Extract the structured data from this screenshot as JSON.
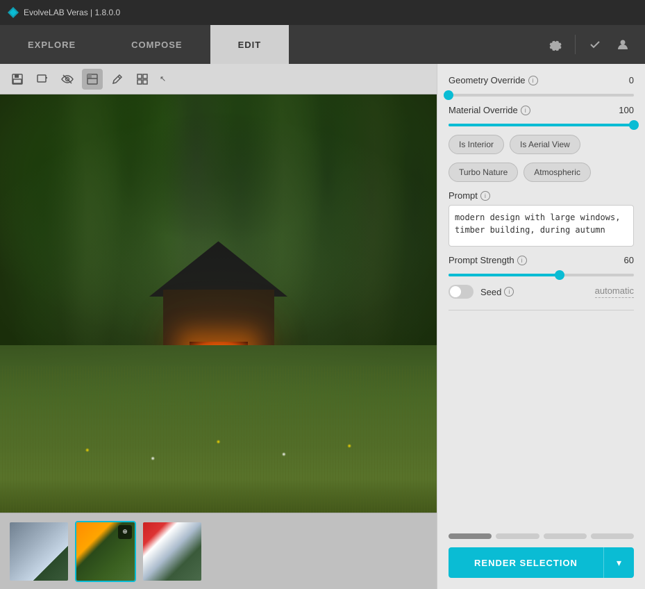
{
  "titlebar": {
    "app_name": "EvolveLAB Veras | 1.8.0.0"
  },
  "navbar": {
    "tabs": [
      {
        "id": "explore",
        "label": "EXPLORE"
      },
      {
        "id": "compose",
        "label": "COMPOSE"
      },
      {
        "id": "edit",
        "label": "EDIT"
      }
    ],
    "active_tab": "edit",
    "icons": {
      "settings": "⚙",
      "check": "✓",
      "user": "👤"
    }
  },
  "toolbar": {
    "tools": [
      {
        "id": "save",
        "icon": "💾",
        "label": "save-tool"
      },
      {
        "id": "add-image",
        "icon": "🖼",
        "label": "add-image-tool"
      },
      {
        "id": "eye-off",
        "icon": "👁",
        "label": "visibility-tool"
      },
      {
        "id": "image-filter",
        "icon": "🏠",
        "label": "image-filter-tool"
      },
      {
        "id": "brush",
        "icon": "✏",
        "label": "brush-tool"
      },
      {
        "id": "grid",
        "icon": "⊞",
        "label": "grid-tool"
      }
    ]
  },
  "right_panel": {
    "geometry_override": {
      "label": "Geometry Override",
      "info": "i",
      "value": 0,
      "min": 0,
      "max": 100,
      "fill_pct": 0
    },
    "material_override": {
      "label": "Material Override",
      "info": "i",
      "value": 100,
      "min": 0,
      "max": 100,
      "fill_pct": 100
    },
    "chips": [
      {
        "id": "is-interior",
        "label": "Is Interior"
      },
      {
        "id": "is-aerial-view",
        "label": "Is Aerial View"
      },
      {
        "id": "turbo-nature",
        "label": "Turbo Nature"
      },
      {
        "id": "atmospheric",
        "label": "Atmospheric"
      }
    ],
    "prompt": {
      "label": "Prompt",
      "info": "i",
      "value": "modern design with large windows, timber building, during autumn"
    },
    "prompt_strength": {
      "label": "Prompt Strength",
      "info": "i",
      "value": 60,
      "min": 0,
      "max": 100,
      "fill_pct": 60
    },
    "seed": {
      "label": "Seed",
      "info": "i",
      "value": "automatic",
      "enabled": false
    },
    "render_button": {
      "label": "RENDER SELECTION",
      "dropdown_icon": "▾"
    }
  },
  "thumbnails": [
    {
      "id": "thumb1",
      "selected": false
    },
    {
      "id": "thumb2",
      "selected": true
    },
    {
      "id": "thumb3",
      "selected": false
    }
  ]
}
